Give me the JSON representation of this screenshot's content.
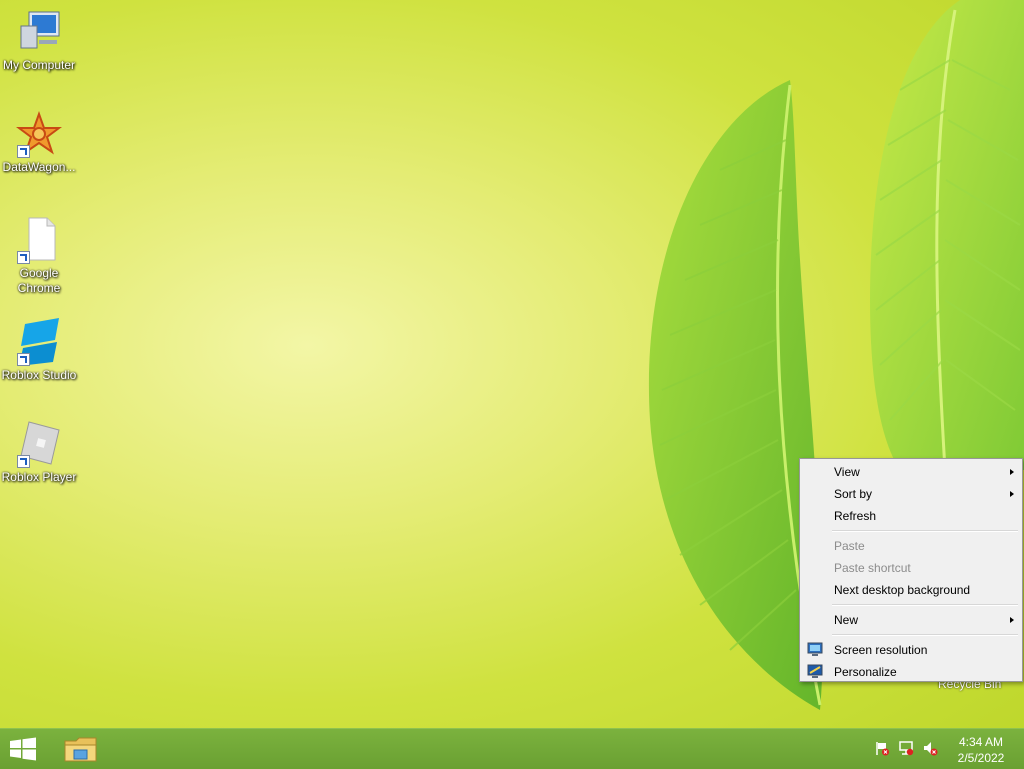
{
  "desktop": {
    "icons": [
      {
        "label": "My Computer",
        "icon": "computer-icon",
        "shortcut": false
      },
      {
        "label": "DataWagon...",
        "icon": "datawagon-icon",
        "shortcut": true
      },
      {
        "label": "Google Chrome",
        "icon": "document-icon",
        "shortcut": true
      },
      {
        "label": "Roblox Studio",
        "icon": "roblox-studio-icon",
        "shortcut": true
      },
      {
        "label": "Roblox Player",
        "icon": "roblox-player-icon",
        "shortcut": true
      }
    ],
    "recycle_bin": {
      "label": "Recycle Bin",
      "icon": "recycle-bin-icon"
    }
  },
  "context_menu": {
    "items": [
      {
        "label": "View",
        "submenu": true,
        "enabled": true
      },
      {
        "label": "Sort by",
        "submenu": true,
        "enabled": true
      },
      {
        "label": "Refresh",
        "submenu": false,
        "enabled": true
      },
      {
        "label": "Paste",
        "submenu": false,
        "enabled": false
      },
      {
        "label": "Paste shortcut",
        "submenu": false,
        "enabled": false
      },
      {
        "label": "Next desktop background",
        "submenu": false,
        "enabled": true
      },
      {
        "label": "New",
        "submenu": true,
        "enabled": true
      },
      {
        "label": "Screen resolution",
        "submenu": false,
        "enabled": true,
        "icon": "monitor-icon"
      },
      {
        "label": "Personalize",
        "submenu": false,
        "enabled": true,
        "icon": "personalize-icon"
      }
    ]
  },
  "taskbar": {
    "start_icon": "windows-logo-icon",
    "pinned": [
      {
        "icon": "file-explorer-icon"
      }
    ],
    "tray": [
      {
        "icon": "action-center-flag-icon"
      },
      {
        "icon": "network-icon"
      },
      {
        "icon": "volume-muted-icon"
      }
    ],
    "clock": {
      "time": "4:34 AM",
      "date": "2/5/2022"
    }
  },
  "colors": {
    "taskbar": "#6aa032",
    "menu_bg": "#f0f0f0",
    "wallpaper": "#d8e64f"
  }
}
